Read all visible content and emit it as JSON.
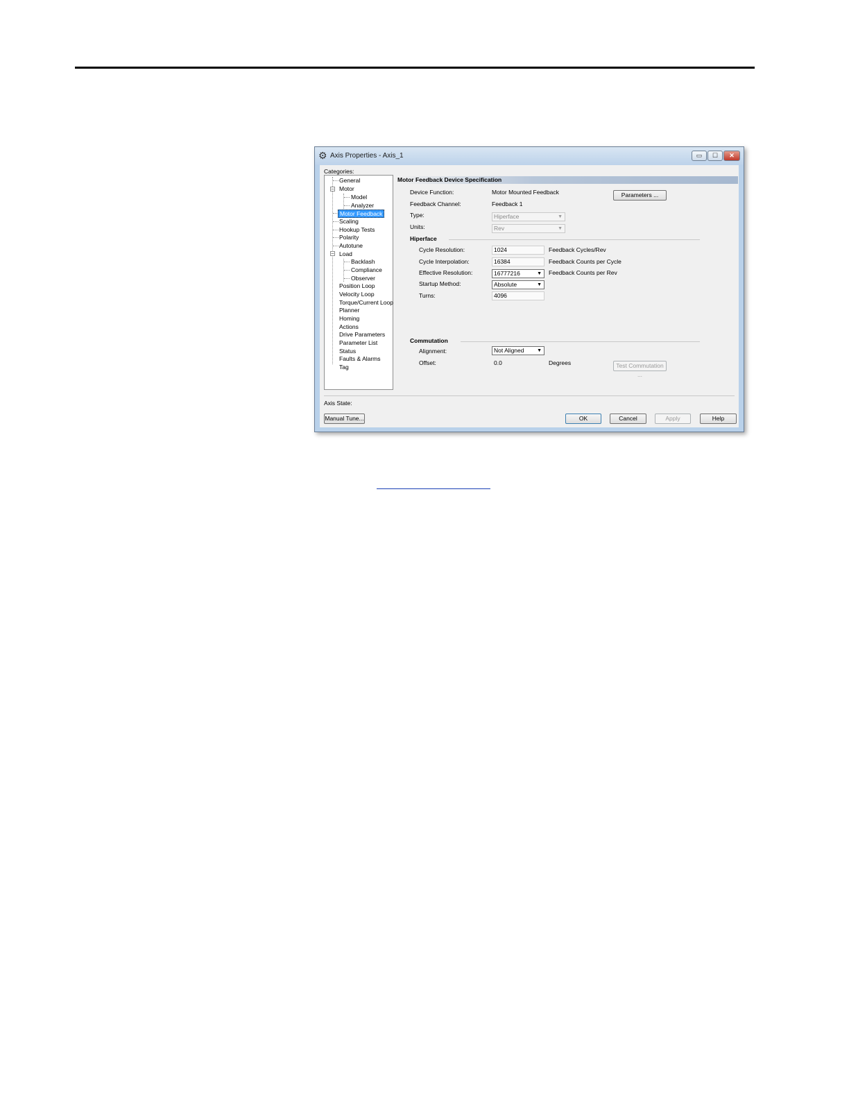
{
  "window": {
    "title": "Axis Properties - Axis_1",
    "controls": {
      "minimize": "▭",
      "maximize": "☐",
      "close": "✕"
    },
    "icon": "gear-icon"
  },
  "categories_label": "Categories:",
  "tree": {
    "general": "General",
    "motor": "Motor",
    "model": "Model",
    "analyzer": "Analyzer",
    "motor_feedback": "Motor Feedback",
    "scaling": "Scaling",
    "hookup_tests": "Hookup Tests",
    "polarity": "Polarity",
    "autotune": "Autotune",
    "load": "Load",
    "backlash": "Backlash",
    "compliance": "Compliance",
    "observer": "Observer",
    "position_loop": "Position Loop",
    "velocity_loop": "Velocity Loop",
    "torque_current_loop": "Torque/Current Loop",
    "planner": "Planner",
    "homing": "Homing",
    "actions": "Actions",
    "drive_parameters": "Drive Parameters",
    "parameter_list": "Parameter List",
    "status": "Status",
    "faults_alarms": "Faults & Alarms",
    "tag": "Tag"
  },
  "section_title": "Motor Feedback Device Specification",
  "device": {
    "function_label": "Device Function:",
    "function_value": "Motor Mounted Feedback",
    "channel_label": "Feedback Channel:",
    "channel_value": "Feedback 1",
    "type_label": "Type:",
    "type_value": "Hiperface",
    "units_label": "Units:",
    "units_value": "Rev",
    "parameters_button": "Parameters ..."
  },
  "hiperface": {
    "title": "Hiperface",
    "cycle_resolution_label": "Cycle Resolution:",
    "cycle_resolution_value": "1024",
    "cycle_resolution_unit": "Feedback Cycles/Rev",
    "cycle_interpolation_label": "Cycle Interpolation:",
    "cycle_interpolation_value": "16384",
    "cycle_interpolation_unit": "Feedback Counts per Cycle",
    "effective_resolution_label": "Effective Resolution:",
    "effective_resolution_value": "16777216",
    "effective_resolution_unit": "Feedback Counts per Rev",
    "startup_method_label": "Startup Method:",
    "startup_method_value": "Absolute",
    "turns_label": "Turns:",
    "turns_value": "4096"
  },
  "commutation": {
    "title": "Commutation",
    "alignment_label": "Alignment:",
    "alignment_value": "Not Aligned",
    "offset_label": "Offset:",
    "offset_value": "0.0",
    "offset_unit": "Degrees",
    "test_button": "Test Commutation ..."
  },
  "footer": {
    "axis_state_label": "Axis State:",
    "manual_tune": "Manual Tune...",
    "ok": "OK",
    "cancel": "Cancel",
    "apply": "Apply",
    "help": "Help"
  }
}
